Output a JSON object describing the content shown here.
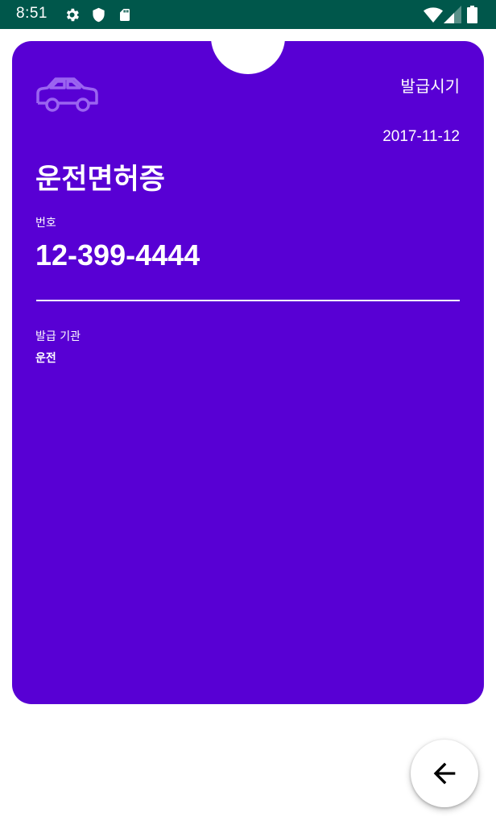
{
  "status_bar": {
    "time": "8:51",
    "left_icons": [
      "gear-icon",
      "shield-icon",
      "sd-card-icon"
    ],
    "right_icons": [
      "wifi-icon",
      "cell-signal-icon",
      "battery-icon"
    ],
    "background_color": "#00574B"
  },
  "card": {
    "background_color": "#5800D4",
    "icon": "car-icon",
    "issue_time_label": "발급시기",
    "issue_date": "2017-11-12",
    "title": "운전면허증",
    "number_label": "번호",
    "number_value": "12-399-4444",
    "issuer_label": "발급 기관",
    "issuer_value": "운전"
  },
  "fab": {
    "icon": "back-arrow-icon"
  }
}
